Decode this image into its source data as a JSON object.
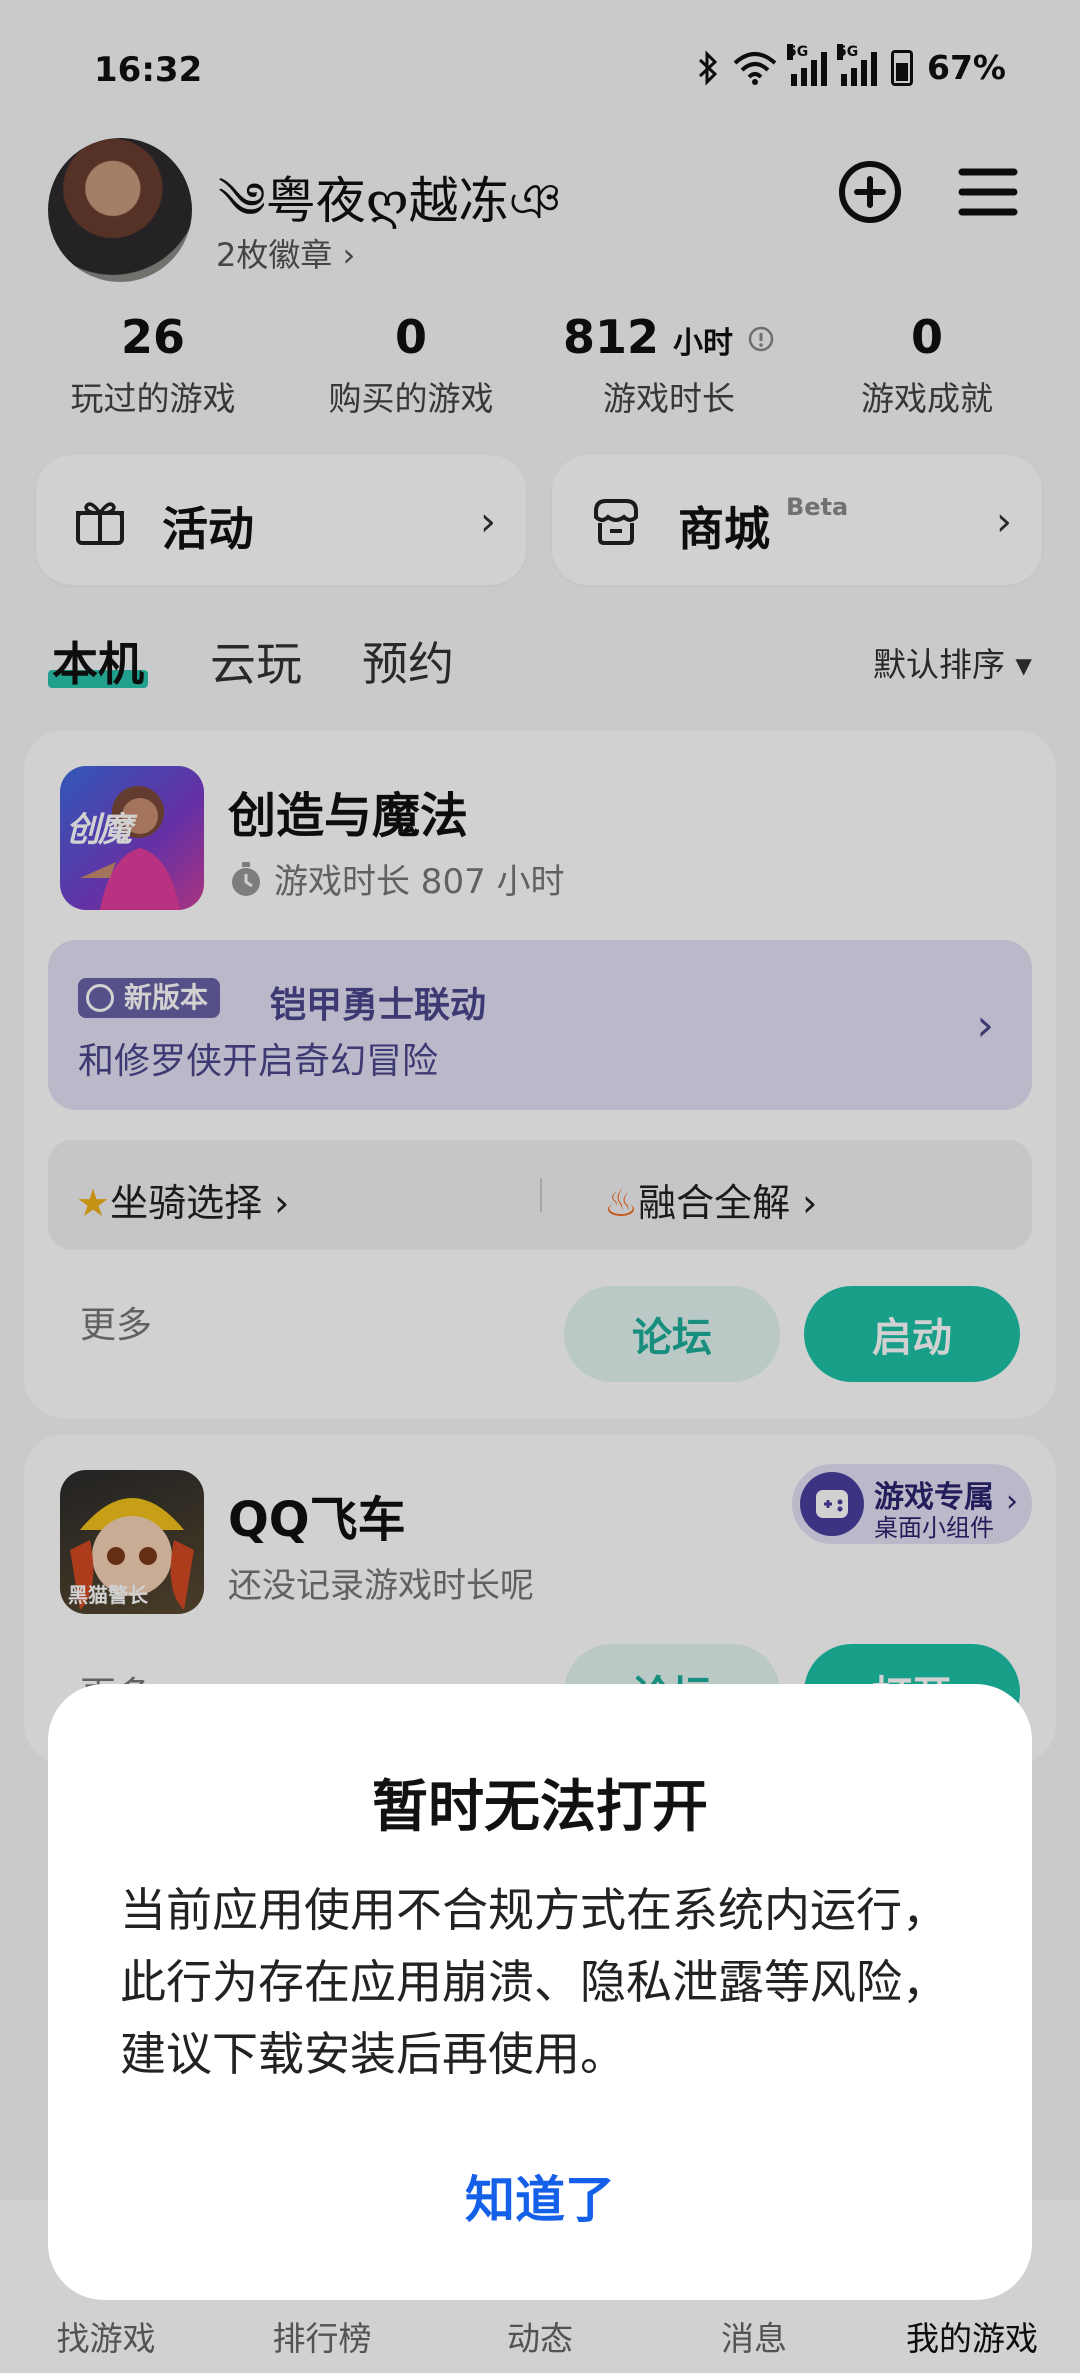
{
  "status": {
    "time": "16:32",
    "network_tag_1": "5G",
    "network_tag_2": "5G",
    "battery": "67%"
  },
  "profile": {
    "username": "༄粤夜ღ越冻ঞ",
    "badges": "2枚徽章",
    "badges_chevron": "›"
  },
  "stats": [
    {
      "value": "26",
      "unit": "",
      "label": "玩过的游戏"
    },
    {
      "value": "0",
      "unit": "",
      "label": "购买的游戏"
    },
    {
      "value": "812",
      "unit": "小时",
      "label": "游戏时长"
    },
    {
      "value": "0",
      "unit": "",
      "label": "游戏成就"
    }
  ],
  "quick": {
    "activity_label": "活动",
    "store_label": "商城",
    "store_beta": "Beta",
    "chevron": "›"
  },
  "tabs": {
    "local": "本机",
    "cloud": "云玩",
    "reserve": "预约",
    "sort": "默认排序 ▾"
  },
  "game1": {
    "name": "创造与魔法",
    "playtime": "游戏时长 807 小时",
    "promo_badge": "新版本",
    "promo_title": "铠甲勇士联动",
    "promo_text": "和修罗侠开启奇幻冒险",
    "guide1": "坐骑选择 ›",
    "guide2": "融合全解 ›",
    "more": "更多",
    "forum": "论坛",
    "launch": "启动",
    "icon_text": "创魔"
  },
  "game2": {
    "name": "QQ飞车",
    "playtime": "还没记录游戏时长呢",
    "widget_line1": "游戏专属",
    "widget_line2": "桌面小组件",
    "more": "更多",
    "forum": "论坛",
    "open": "打开",
    "icon_text": "黑猫警长"
  },
  "bottom_nav": [
    "找游戏",
    "排行榜",
    "动态",
    "消息",
    "我的游戏"
  ],
  "dialog": {
    "title": "暂时无法打开",
    "body": "当前应用使用不合规方式在系统内运行，此行为存在应用崩溃、隐私泄露等风险，建议下载安装后再使用。",
    "button": "知道了"
  },
  "colors": {
    "accent": "#1ec2a8",
    "promo_bg": "#e4e2f6",
    "promo_text": "#4b468d",
    "dialog_button": "#1560e8"
  }
}
